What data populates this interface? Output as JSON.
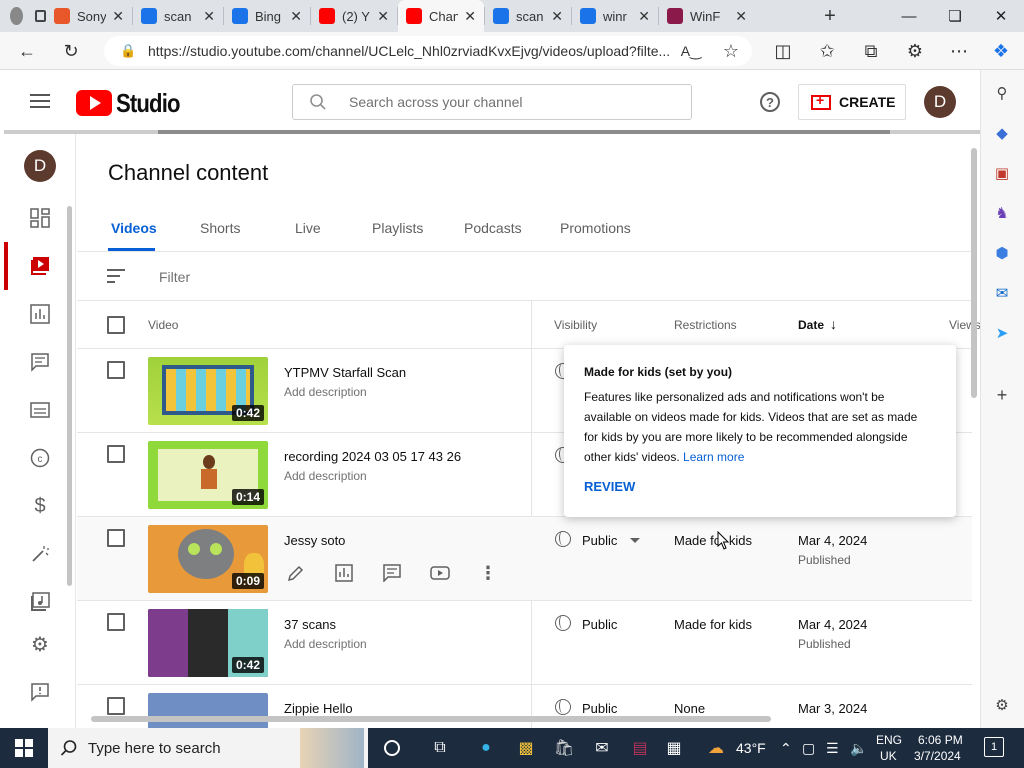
{
  "browser": {
    "tabs": [
      {
        "label": "Sony",
        "icon": "brave-icon",
        "color": "#e8572a"
      },
      {
        "label": "scan",
        "icon": "search-icon",
        "color": "#1a73e8"
      },
      {
        "label": "Bing",
        "icon": "search-icon",
        "color": "#1a73e8"
      },
      {
        "label": "(2) Y",
        "icon": "youtube-icon",
        "color": "#ff0000"
      },
      {
        "label": "Chan",
        "icon": "youtube-studio-icon",
        "color": "#ff0000"
      },
      {
        "label": "scan",
        "icon": "scan-icon",
        "color": "#1a73e8"
      },
      {
        "label": "winr",
        "icon": "search-icon",
        "color": "#1a73e8"
      },
      {
        "label": "WinF",
        "icon": "winrar-icon",
        "color": "#8b1a4a"
      }
    ],
    "url": "https://studio.youtube.com/channel/UCLelc_Nhl0zrviadKvxEjvg/videos/upload?filte..."
  },
  "header": {
    "app_name": "Studio",
    "search_placeholder": "Search across your channel",
    "create_label": "CREATE",
    "avatar_initial": "D"
  },
  "page": {
    "title": "Channel content",
    "tabs": [
      "Videos",
      "Shorts",
      "Live",
      "Playlists",
      "Podcasts",
      "Promotions"
    ],
    "filter_placeholder": "Filter",
    "columns": {
      "video": "Video",
      "visibility": "Visibility",
      "restrictions": "Restrictions",
      "date": "Date",
      "views": "Views"
    }
  },
  "rows": [
    {
      "title": "YTPMV Starfall Scan",
      "desc": "Add description",
      "duration": "0:42",
      "visibility": "",
      "restrictions": "",
      "date": "",
      "status": ""
    },
    {
      "title": "recording 2024 03 05 17 43 26",
      "desc": "Add description",
      "duration": "0:14",
      "visibility": "",
      "restrictions": "",
      "date": "",
      "status": ""
    },
    {
      "title": "Jessy soto",
      "desc": "",
      "duration": "0:09",
      "visibility": "Public",
      "restrictions": "Made for kids",
      "date": "Mar 4, 2024",
      "status": "Published"
    },
    {
      "title": "37 scans",
      "desc": "Add description",
      "duration": "0:42",
      "visibility": "Public",
      "restrictions": "Made for kids",
      "date": "Mar 4, 2024",
      "status": "Published"
    },
    {
      "title": "Zippie Hello",
      "desc": "",
      "duration": "",
      "visibility": "Public",
      "restrictions": "None",
      "date": "Mar 3, 2024",
      "status": ""
    }
  ],
  "tooltip": {
    "title": "Made for kids (set by you)",
    "body": "Features like personalized ads and notifications won't be available on videos made for kids. Videos that are set as made for kids by you are more likely to be recommended alongside other kids' videos.",
    "link": "Learn more",
    "action": "REVIEW"
  },
  "taskbar": {
    "search_placeholder": "Type here to search",
    "weather": "43°F",
    "lang_1": "ENG",
    "lang_2": "UK",
    "time": "6:06 PM",
    "date": "3/7/2024",
    "notification_count": "1"
  },
  "colors": {
    "accent": "#065fd4",
    "brand_red": "#ff0000",
    "active_nav": "#cc0000"
  }
}
